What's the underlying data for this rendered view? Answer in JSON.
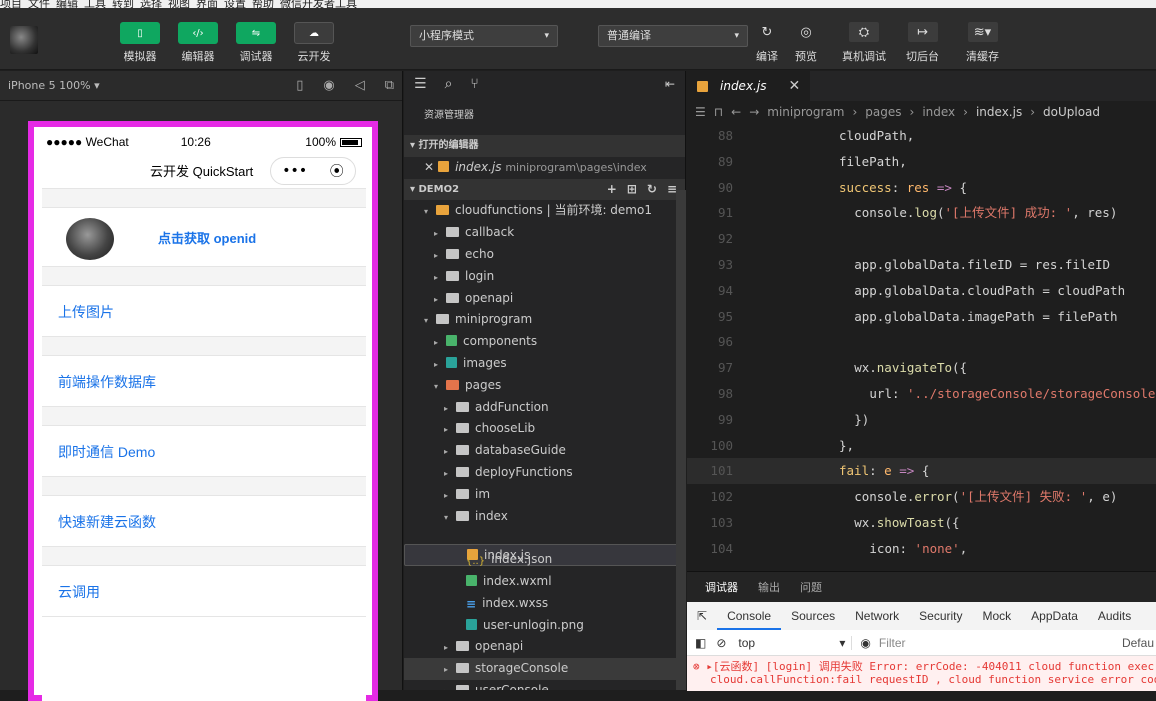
{
  "menubar": {
    "items": [
      "项目",
      "文件",
      "编辑",
      "工具",
      "转到",
      "选择",
      "视图",
      "界面",
      "设置",
      "帮助",
      "微信开发者工具"
    ]
  },
  "toolbar": {
    "buttons": [
      {
        "label": "模拟器",
        "icon": "phone-icon"
      },
      {
        "label": "编辑器",
        "icon": "code-icon"
      },
      {
        "label": "调试器",
        "icon": "debug-icon"
      },
      {
        "label": "云开发",
        "icon": "cloud-icon"
      }
    ],
    "mode_select": "小程序模式",
    "compile_select": "普通编译",
    "actions": [
      {
        "label": "编译",
        "icon": "refresh-icon"
      },
      {
        "label": "预览",
        "icon": "eye-icon"
      },
      {
        "label": "真机调试",
        "icon": "bug-icon"
      },
      {
        "label": "切后台",
        "icon": "switch-icon"
      },
      {
        "label": "清缓存",
        "icon": "layers-icon"
      }
    ]
  },
  "simulator": {
    "device": "iPhone 5 100% ▾",
    "status_carrier": "●●●●● WeChat",
    "status_time": "10:26",
    "status_battery": "100%",
    "nav_title": "云开发 QuickStart",
    "openid_label": "点击获取 openid",
    "menu": [
      "上传图片",
      "前端操作数据库",
      "即时通信 Demo",
      "快速新建云函数",
      "云调用"
    ]
  },
  "explorer": {
    "title": "资源管理器",
    "open_editors": "▾ 打开的编辑器",
    "open_file": "index.js",
    "open_file_path": "miniprogram\\pages\\index",
    "project": "▾ DEMO2",
    "tree": [
      {
        "label": "cloudfunctions | 当前环境: demo1",
        "indent": 1,
        "type": "ofolder",
        "open": true
      },
      {
        "label": "callback",
        "indent": 2,
        "type": "folder"
      },
      {
        "label": "echo",
        "indent": 2,
        "type": "folder"
      },
      {
        "label": "login",
        "indent": 2,
        "type": "folder"
      },
      {
        "label": "openapi",
        "indent": 2,
        "type": "folder"
      },
      {
        "label": "miniprogram",
        "indent": 1,
        "type": "folder",
        "open": true
      },
      {
        "label": "components",
        "indent": 2,
        "type": "green"
      },
      {
        "label": "images",
        "indent": 2,
        "type": "teal"
      },
      {
        "label": "pages",
        "indent": 2,
        "type": "red",
        "open": true
      },
      {
        "label": "addFunction",
        "indent": 3,
        "type": "folder"
      },
      {
        "label": "chooseLib",
        "indent": 3,
        "type": "folder"
      },
      {
        "label": "databaseGuide",
        "indent": 3,
        "type": "folder"
      },
      {
        "label": "deployFunctions",
        "indent": 3,
        "type": "folder"
      },
      {
        "label": "im",
        "indent": 3,
        "type": "folder"
      },
      {
        "label": "index",
        "indent": 3,
        "type": "folder",
        "open": true
      },
      {
        "label": "index.js",
        "indent": 4,
        "type": "js",
        "selected": true
      },
      {
        "label": "index.json",
        "indent": 4,
        "type": "json"
      },
      {
        "label": "index.wxml",
        "indent": 4,
        "type": "green"
      },
      {
        "label": "index.wxss",
        "indent": 4,
        "type": "css"
      },
      {
        "label": "user-unlogin.png",
        "indent": 4,
        "type": "teal"
      },
      {
        "label": "openapi",
        "indent": 3,
        "type": "folder"
      },
      {
        "label": "storageConsole",
        "indent": 3,
        "type": "folder",
        "hl": true
      },
      {
        "label": "userConsole",
        "indent": 3,
        "type": "folder"
      }
    ]
  },
  "editor": {
    "tab": "index.js",
    "breadcrumb": [
      "miniprogram",
      "pages",
      "index",
      "index.js",
      "doUpload"
    ],
    "lines": [
      {
        "n": "88",
        "html": "<span class='p'>cloudPath,</span>",
        "indent": 6
      },
      {
        "n": "89",
        "html": "<span class='p'>filePath,</span>",
        "indent": 6
      },
      {
        "n": "90",
        "html": "<span class='k'>success</span><span class='p'>: </span><span class='n'>res</span><span class='o'> =&gt; </span><span class='p'>{</span>",
        "indent": 6
      },
      {
        "n": "91",
        "html": "<span class='p'>console.</span><span class='f'>log</span><span class='p'>(</span><span class='s'>'[上传文件] 成功: '</span><span class='p'>, res)</span>",
        "indent": 8
      },
      {
        "n": "92",
        "html": "",
        "indent": 0
      },
      {
        "n": "93",
        "html": "<span class='p'>app.globalData.fileID = res.fileID</span>",
        "indent": 8
      },
      {
        "n": "94",
        "html": "<span class='p'>app.globalData.cloudPath = cloudPath</span>",
        "indent": 8
      },
      {
        "n": "95",
        "html": "<span class='p'>app.globalData.imagePath = filePath</span>",
        "indent": 8
      },
      {
        "n": "96",
        "html": "",
        "indent": 0
      },
      {
        "n": "97",
        "html": "<span class='p'>wx.</span><span class='f'>navigateTo</span><span class='p'>({</span>",
        "indent": 8
      },
      {
        "n": "98",
        "html": "<span class='p'>url: </span><span class='s'>'../storageConsole/storageConsole'</span>",
        "indent": 10
      },
      {
        "n": "99",
        "html": "<span class='p'>})</span>",
        "indent": 8
      },
      {
        "n": "100",
        "html": "<span class='p'>},</span>",
        "indent": 6
      },
      {
        "n": "101",
        "html": "<span class='k'>fail</span><span class='p'>: </span><span class='n'>e</span><span class='o'> =&gt; </span><span class='p'>{</span>",
        "indent": 6,
        "cur": true
      },
      {
        "n": "102",
        "html": "<span class='p'>console.</span><span class='f'>error</span><span class='p'>(</span><span class='s'>'[上传文件] 失败: '</span><span class='p'>, e)</span>",
        "indent": 8
      },
      {
        "n": "103",
        "html": "<span class='p'>wx.</span><span class='f'>showToast</span><span class='p'>({</span>",
        "indent": 8
      },
      {
        "n": "104",
        "html": "<span class='p'>icon: </span><span class='s'>'none'</span><span class='p'>,</span>",
        "indent": 10
      }
    ]
  },
  "debug": {
    "tabs": [
      "调试器",
      "输出",
      "问题"
    ],
    "console_tabs": [
      "Console",
      "Sources",
      "Network",
      "Security",
      "Mock",
      "AppData",
      "Audits"
    ],
    "context": "top",
    "filter_placeholder": "Filter",
    "levels": "Defau",
    "error_line1": "▸[云函数] [login] 调用失败 Error: errCode: -404011 cloud function exec",
    "error_line2": "cloud.callFunction:fail requestID , cloud function service error code"
  }
}
